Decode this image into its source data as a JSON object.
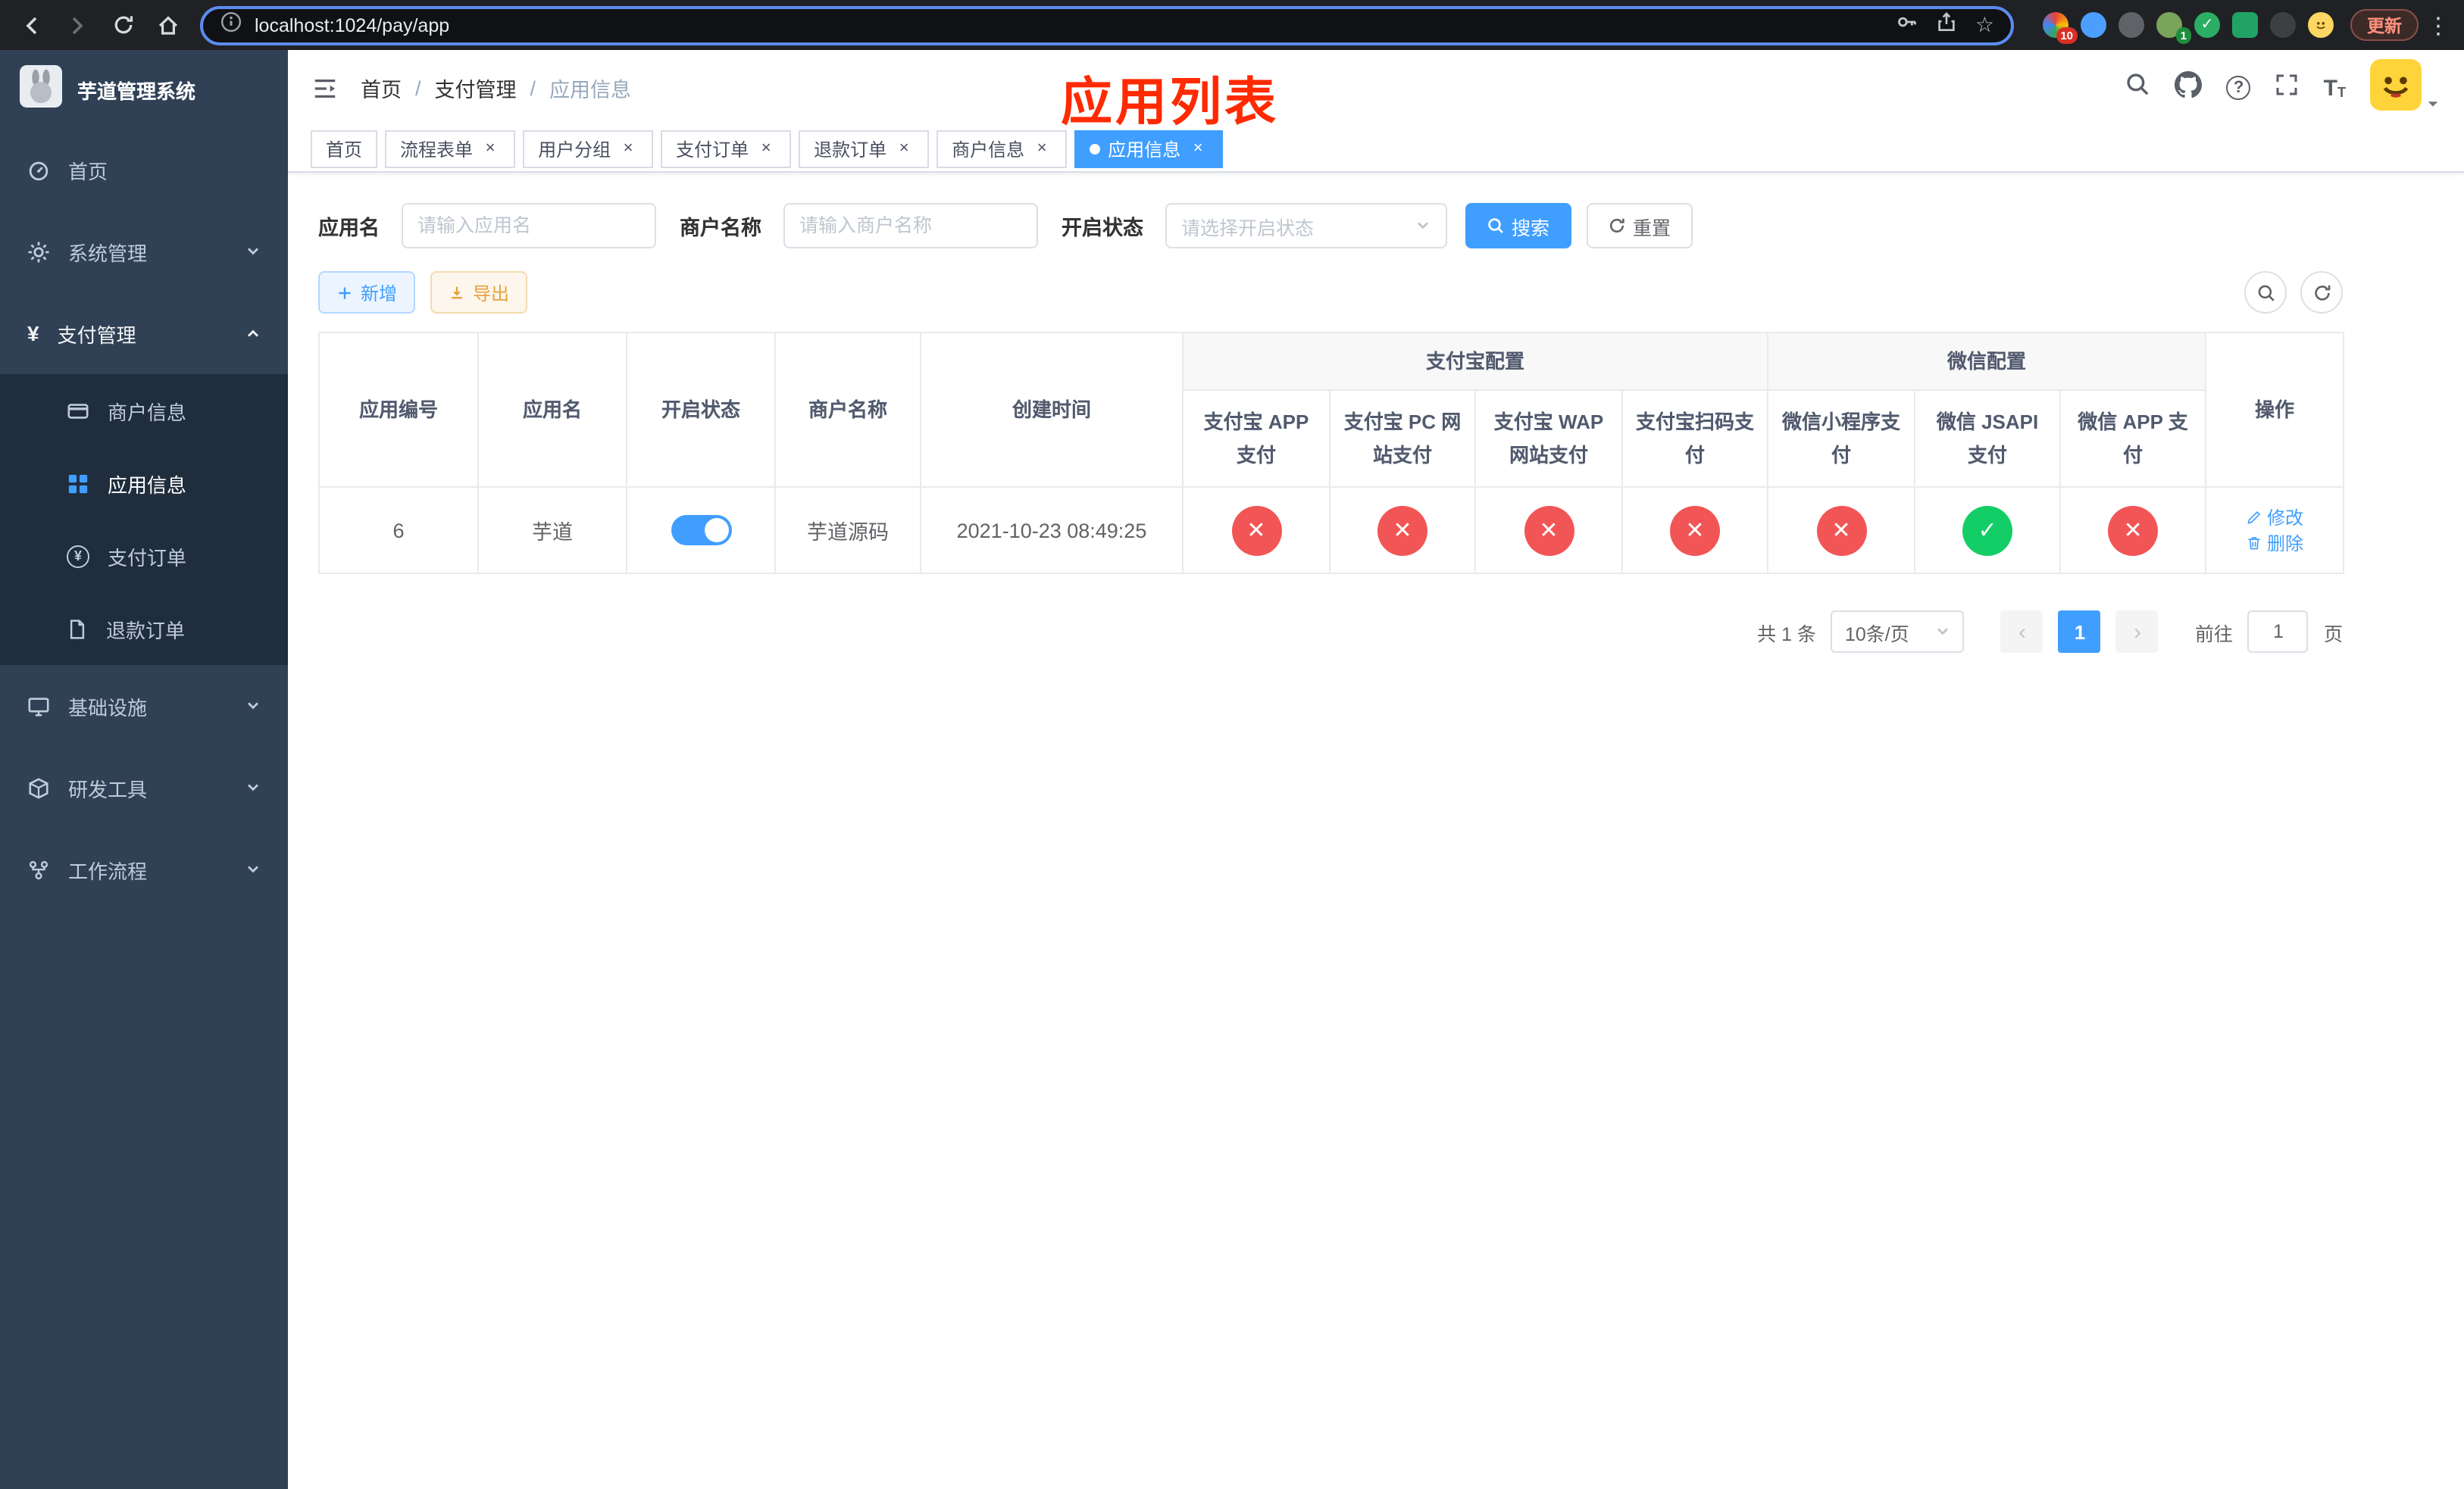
{
  "colors": {
    "primary": "#409eff",
    "success": "#13ce66",
    "danger": "#f25555",
    "warning": "#e6a23c",
    "sidebar_bg": "#304156",
    "submenu_bg": "#1f2d3d",
    "annotation_red": "#ff2a00"
  },
  "icons": {
    "close": "×",
    "check": "✓",
    "cross": "✕",
    "prev": "‹",
    "next": "›",
    "question": "?",
    "font_size_big": "T",
    "font_size_small": "T",
    "star": "☆",
    "menu_dots": "⋮",
    "yen": "¥"
  },
  "browser": {
    "url": "localhost:1024/pay/app",
    "update_button": "更新",
    "extension_badge_count": "10",
    "avatar_badge_count": "1"
  },
  "sidebar": {
    "title": "芋道管理系统",
    "items": [
      {
        "label": "首页"
      },
      {
        "label": "系统管理"
      },
      {
        "label": "支付管理"
      },
      {
        "label": "基础设施"
      },
      {
        "label": "研发工具"
      },
      {
        "label": "工作流程"
      }
    ],
    "payment_children": [
      {
        "label": "商户信息"
      },
      {
        "label": "应用信息"
      },
      {
        "label": "支付订单"
      },
      {
        "label": "退款订单"
      }
    ]
  },
  "navbar": {
    "breadcrumb": [
      "首页",
      "支付管理",
      "应用信息"
    ],
    "annotation": "应用列表"
  },
  "tabs": [
    {
      "label": "首页"
    },
    {
      "label": "流程表单"
    },
    {
      "label": "用户分组"
    },
    {
      "label": "支付订单"
    },
    {
      "label": "退款订单"
    },
    {
      "label": "商户信息"
    },
    {
      "label": "应用信息"
    }
  ],
  "filters": {
    "app_name_label": "应用名",
    "app_name_placeholder": "请输入应用名",
    "merchant_label": "商户名称",
    "merchant_placeholder": "请输入商户名称",
    "status_label": "开启状态",
    "status_placeholder": "请选择开启状态",
    "search_button": "搜索",
    "reset_button": "重置"
  },
  "toolbar": {
    "add_button": "新增",
    "export_button": "导出"
  },
  "table": {
    "groups": {
      "alipay": "支付宝配置",
      "wechat": "微信配置"
    },
    "columns": [
      "应用编号",
      "应用名",
      "开启状态",
      "商户名称",
      "创建时间",
      "支付宝 APP 支付",
      "支付宝 PC 网站支付",
      "支付宝 WAP 网站支付",
      "支付宝扫码支付",
      "微信小程序支付",
      "微信 JSAPI 支付",
      "微信 APP 支付",
      "操作"
    ],
    "row": {
      "id": "6",
      "name": "芋道",
      "enabled": true,
      "merchant": "芋道源码",
      "created_at": "2021-10-23 08:49:25",
      "status": {
        "alipay_app": false,
        "alipay_pc": false,
        "alipay_wap": false,
        "alipay_qr": false,
        "wechat_lite": false,
        "wechat_jsapi": true,
        "wechat_app": false
      },
      "edit_label": "修改",
      "delete_label": "删除"
    }
  },
  "pagination": {
    "total": "共 1 条",
    "page_size": "10条/页",
    "current_page": "1",
    "goto_label": "前往",
    "goto_value": "1",
    "goto_unit": "页"
  }
}
